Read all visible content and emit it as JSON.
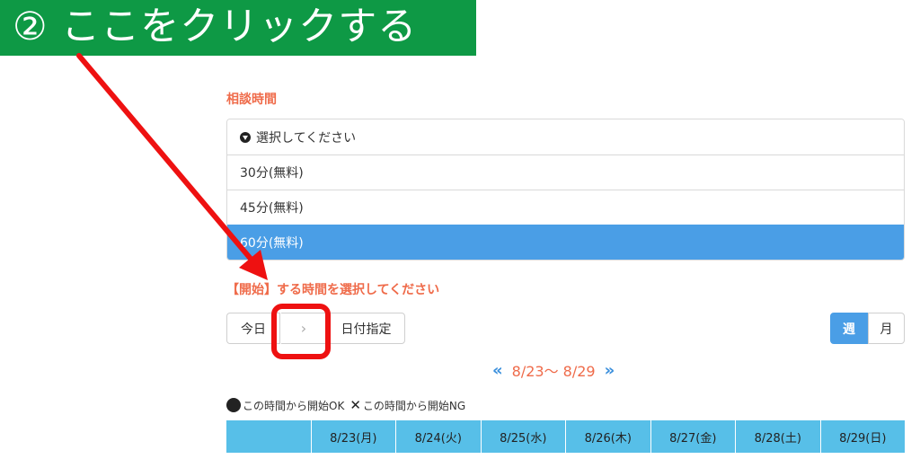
{
  "banner": {
    "text": "② ここをクリックする",
    "color": "#0e9945"
  },
  "consult": {
    "label": "相談時間",
    "placeholder": "選択してください",
    "options": [
      "30分(無料)",
      "45分(無料)",
      "60分(無料)"
    ],
    "selected": "60分(無料)"
  },
  "start": {
    "label": "【開始】する時間を選択してください"
  },
  "toolbar": {
    "today": "今日",
    "next": "›",
    "date": "日付指定",
    "week": "週",
    "month": "月"
  },
  "range": {
    "prev": "«",
    "text": "8/23〜 8/29",
    "next": "»"
  },
  "legend": {
    "ok": "この時間から開始OK",
    "ng_mark": "✕",
    "ng": "この時間から開始NG"
  },
  "calendar": {
    "corner": "",
    "days": [
      "8/23(月)",
      "8/24(火)",
      "8/25(水)",
      "8/26(木)",
      "8/27(金)",
      "8/28(土)",
      "8/29(日)"
    ]
  },
  "colors": {
    "accent": "#4a9ee6",
    "label": "#ef6b4a",
    "header": "#57bfe8",
    "highlight": "#ee1111"
  }
}
